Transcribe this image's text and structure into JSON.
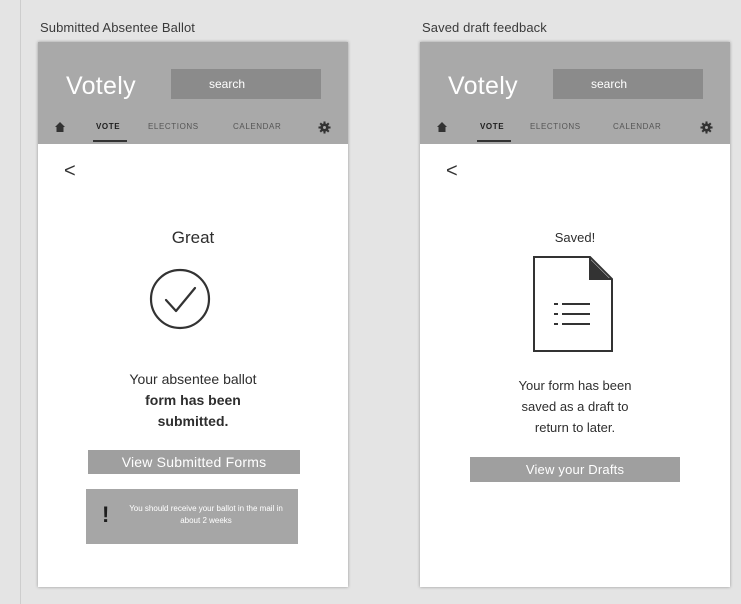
{
  "frames": [
    {
      "title": "Submitted Absentee Ballot",
      "app": {
        "logo": "Votely",
        "search_placeholder": "search",
        "nav": {
          "home_icon": "home-icon",
          "items": [
            "VOTE",
            "ELECTIONS",
            "CALENDAR"
          ],
          "active": "VOTE",
          "settings_icon": "gear-icon"
        }
      },
      "back_label": "<",
      "heading": "Great",
      "icon": "check-circle-icon",
      "message_line1": "Your absentee ballot",
      "message_line2": "form has been",
      "message_line3": "submitted.",
      "button_label": "View Submitted Forms",
      "notice": {
        "icon": "exclamation-icon",
        "symbol": "!",
        "text": "You should receive your ballot in the mail in about 2 weeks"
      }
    },
    {
      "title": "Saved draft feedback",
      "app": {
        "logo": "Votely",
        "search_placeholder": "search",
        "nav": {
          "home_icon": "home-icon",
          "items": [
            "VOTE",
            "ELECTIONS",
            "CALENDAR"
          ],
          "active": "VOTE",
          "settings_icon": "gear-icon"
        }
      },
      "back_label": "<",
      "heading": "Saved!",
      "icon": "document-list-icon",
      "message_line1": "Your form has been",
      "message_line2": "saved as a draft to",
      "message_line3": "return to later.",
      "button_label": "View your Drafts"
    }
  ],
  "colors": {
    "header": "#a9a9a9",
    "search_box": "#8b8b8b",
    "button": "#9f9f9f",
    "canvas": "#e4e4e4"
  }
}
